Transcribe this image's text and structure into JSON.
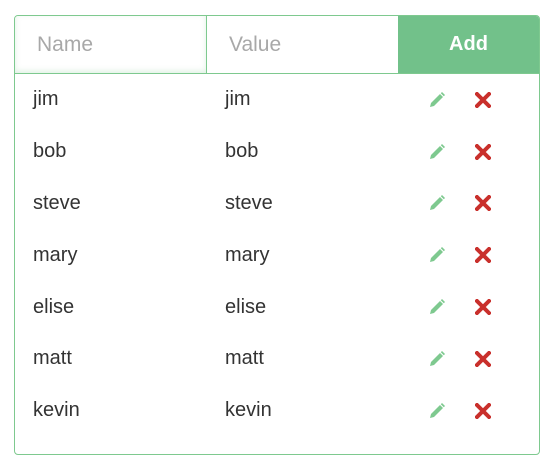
{
  "form": {
    "name_placeholder": "Name",
    "value_placeholder": "Value",
    "add_label": "Add"
  },
  "entries": [
    {
      "name": "jim",
      "value": "jim"
    },
    {
      "name": "bob",
      "value": "bob"
    },
    {
      "name": "steve",
      "value": "steve"
    },
    {
      "name": "mary",
      "value": "mary"
    },
    {
      "name": "elise",
      "value": "elise"
    },
    {
      "name": "matt",
      "value": "matt"
    },
    {
      "name": "kevin",
      "value": "kevin"
    }
  ],
  "icons": {
    "edit": "pencil-icon",
    "delete": "close-icon"
  },
  "colors": {
    "accent": "#72c18a",
    "border": "#7ec98f",
    "edit_icon": "#7ec98f",
    "delete_icon": "#c9302c"
  }
}
